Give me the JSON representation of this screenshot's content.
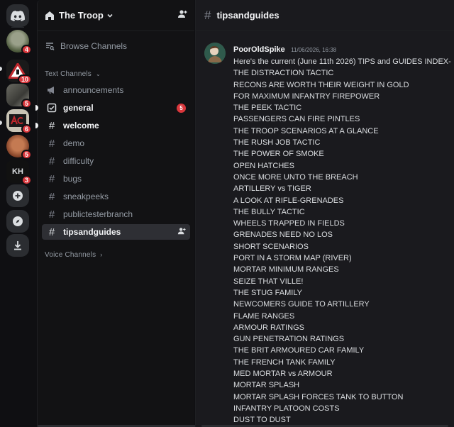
{
  "server": {
    "name": "The Troop"
  },
  "rail": {
    "badges": [
      "4",
      "10",
      "5",
      "6",
      "5",
      "3"
    ],
    "av6_text": "KH"
  },
  "sidebar": {
    "browse_label": "Browse Channels",
    "text_category": "Text Channels",
    "voice_category": "Voice Channels",
    "channels": [
      {
        "label": "announcements"
      },
      {
        "label": "general",
        "badge": "5"
      },
      {
        "label": "welcome"
      },
      {
        "label": "demo"
      },
      {
        "label": "difficulty"
      },
      {
        "label": "bugs"
      },
      {
        "label": "sneakpeeks"
      },
      {
        "label": "publictesterbranch"
      },
      {
        "label": "tipsandguides"
      }
    ]
  },
  "topbar": {
    "channel": "tipsandguides"
  },
  "message": {
    "author": "PoorOldSpike",
    "timestamp": "11/06/2026, 16:38",
    "lines": [
      "Here's the current (June 11th 2026) TIPS and GUIDES INDEX-",
      "THE DISTRACTION TACTIC",
      "RECONS ARE WORTH THEIR WEIGHT IN GOLD",
      "FOR MAXIMUM INFANTRY FIREPOWER",
      "THE PEEK TACTIC",
      "PASSENGERS CAN FIRE PINTLES",
      "THE TROOP SCENARIOS AT A GLANCE",
      "THE RUSH JOB TACTIC",
      "THE POWER OF SMOKE",
      "OPEN HATCHES",
      "ONCE MORE UNTO THE BREACH",
      "ARTILLERY vs TIGER",
      "A LOOK AT RIFLE-GRENADES",
      "THE BULLY TACTIC",
      "WHEELS TRAPPED IN FIELDS",
      "GRENADES NEED NO LOS",
      "SHORT SCENARIOS",
      "PORT IN A STORM MAP (RIVER)",
      "MORTAR MINIMUM RANGES",
      "SEIZE THAT VILLE!",
      "THE STUG FAMILY",
      "NEWCOMERS GUIDE TO ARTILLERY",
      "FLAME RANGES",
      "ARMOUR RATINGS",
      "GUN PENETRATION RATINGS",
      "THE BRIT ARMOURED CAR FAMILY",
      "THE FRENCH TANK FAMILY",
      "MED MORTAR vs ARMOUR",
      "MORTAR SPLASH",
      "MORTAR SPLASH  FORCES TANK TO BUTTON",
      "INFANTRY PLATOON COSTS",
      "DUST TO DUST"
    ]
  },
  "colors": {
    "badge": "#da373c",
    "rail_bg": "#0f0f12",
    "sidebar_bg": "#121214",
    "main_bg": "#1a1a1e"
  }
}
